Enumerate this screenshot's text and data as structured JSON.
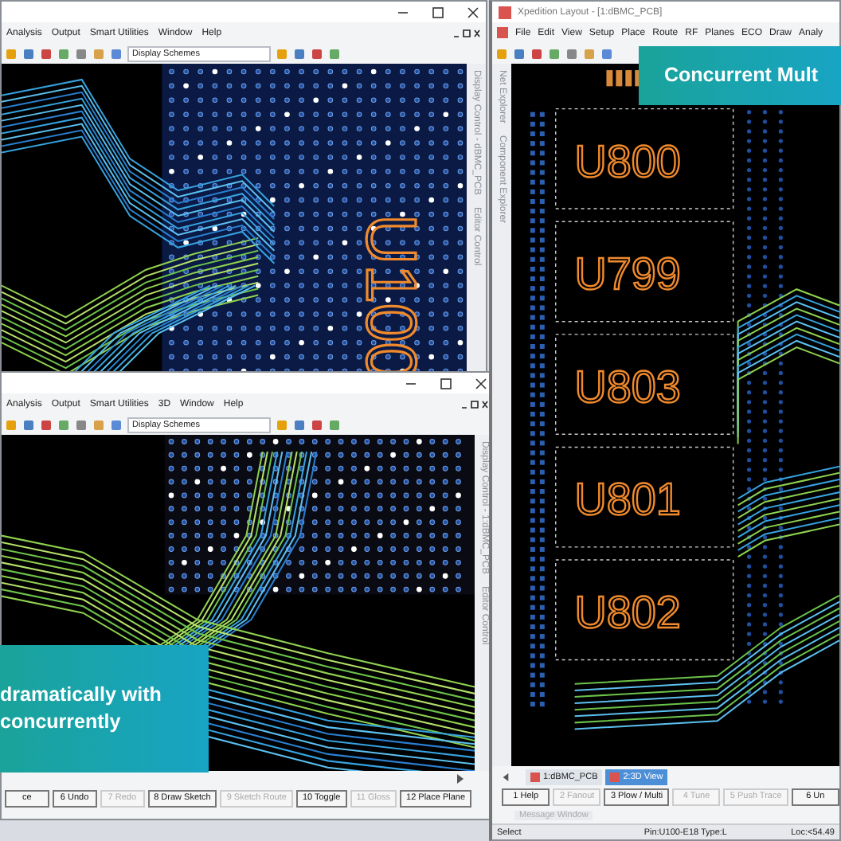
{
  "top_window": {
    "menu": [
      "Analysis",
      "Output",
      "Smart Utilities",
      "Window",
      "Help"
    ],
    "toolbar_combo": "Display Schemes",
    "side_tabs": [
      "Display Control - dBMC_PCB",
      "Editor Control"
    ],
    "component_label": "U100"
  },
  "layout_window": {
    "title": "Xpedition Layout - [1:dBMC_PCB]",
    "menu": [
      "File",
      "Edit",
      "View",
      "Setup",
      "Place",
      "Route",
      "RF",
      "Planes",
      "ECO",
      "Draw",
      "Analy"
    ],
    "side_tabs": [
      "Net Explorer",
      "Component Explorer"
    ],
    "components": [
      "U800",
      "U799",
      "U803",
      "U801",
      "U802"
    ],
    "view_tabs": [
      {
        "label": "1:dBMC_PCB",
        "selected": false
      },
      {
        "label": "2:3D View",
        "selected": true
      }
    ],
    "function_keys": [
      {
        "label": "1 Help",
        "disabled": false
      },
      {
        "label": "2 Fanout",
        "disabled": true
      },
      {
        "label": "3 Plow / Multi",
        "disabled": false
      },
      {
        "label": "4 Tune",
        "disabled": true
      },
      {
        "label": "5 Push Trace",
        "disabled": true
      },
      {
        "label": "6 Un",
        "disabled": false
      }
    ],
    "message_window": "Message Window",
    "status_bar": [
      "Select",
      "Pin:U100-E18 Type:L",
      "Loc:<54.49"
    ]
  },
  "bottom_window": {
    "menu": [
      "Analysis",
      "Output",
      "Smart Utilities",
      "3D",
      "Window",
      "Help"
    ],
    "toolbar_combo": "Display Schemes",
    "side_tabs": [
      "Display Control - 1:dBMC_PCB",
      "Editor Control"
    ],
    "function_keys": [
      {
        "label": "ce",
        "disabled": false
      },
      {
        "label": "6 Undo",
        "disabled": false
      },
      {
        "label": "7 Redo",
        "disabled": true
      },
      {
        "label": "8 Draw Sketch",
        "disabled": false
      },
      {
        "label": "9 Sketch Route",
        "disabled": true
      },
      {
        "label": "10 Toggle",
        "disabled": false
      },
      {
        "label": "11 Gloss",
        "disabled": true
      },
      {
        "label": "12 Place Plane",
        "disabled": false
      }
    ]
  },
  "banners": [
    {
      "lines": [
        "Concurrent Mult"
      ]
    },
    {
      "lines": [
        "dramatically with",
        "concurrently"
      ]
    }
  ]
}
